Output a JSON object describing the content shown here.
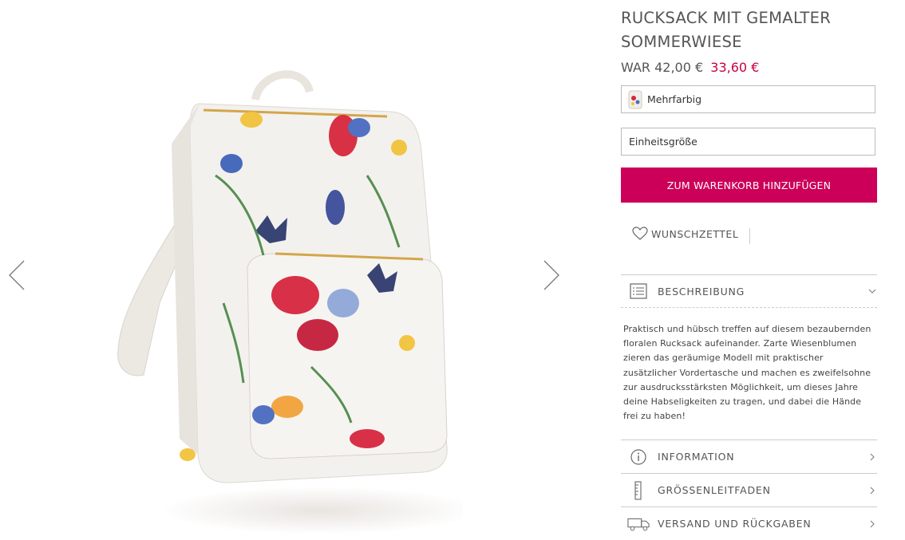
{
  "product": {
    "title": "RUCKSACK MIT GEMALTER SOMMERWIESE",
    "price_was": "WAR 42,00 €",
    "price_now": "33,60 €",
    "colour": "Mehrfarbig",
    "size": "Einheitsgröße",
    "add_to_cart": "ZUM WARENKORB HINZUFÜGEN",
    "wishlist": "WUNSCHZETTEL"
  },
  "accordion": {
    "description_label": "BESCHREIBUNG",
    "description_text": "Praktisch und hübsch treffen auf diesem bezaubernden floralen Rucksack aufeinander. Zarte Wiesenblumen zieren das geräumige Modell mit praktischer zusätzlicher Vordertasche und machen es zweifelsohne zur ausdrucksstärksten Möglichkeit, um dieses Jahre deine Habseligkeiten zu tragen, und dabei die Hände frei zu haben!",
    "information_label": "INFORMATION",
    "size_guide_label": "GRÖSSENLEITFADEN",
    "shipping_label": "VERSAND UND RÜCKGABEN"
  },
  "colors": {
    "accent": "#cc0059",
    "sale_price": "#c8003f",
    "text": "#555555",
    "border": "#bbbbbb"
  },
  "icons": {
    "prev": "chevron-left-icon",
    "next": "chevron-right-icon",
    "wishlist": "heart-icon",
    "description": "list-icon",
    "information": "info-icon",
    "size_guide": "ruler-icon",
    "shipping": "truck-icon"
  }
}
